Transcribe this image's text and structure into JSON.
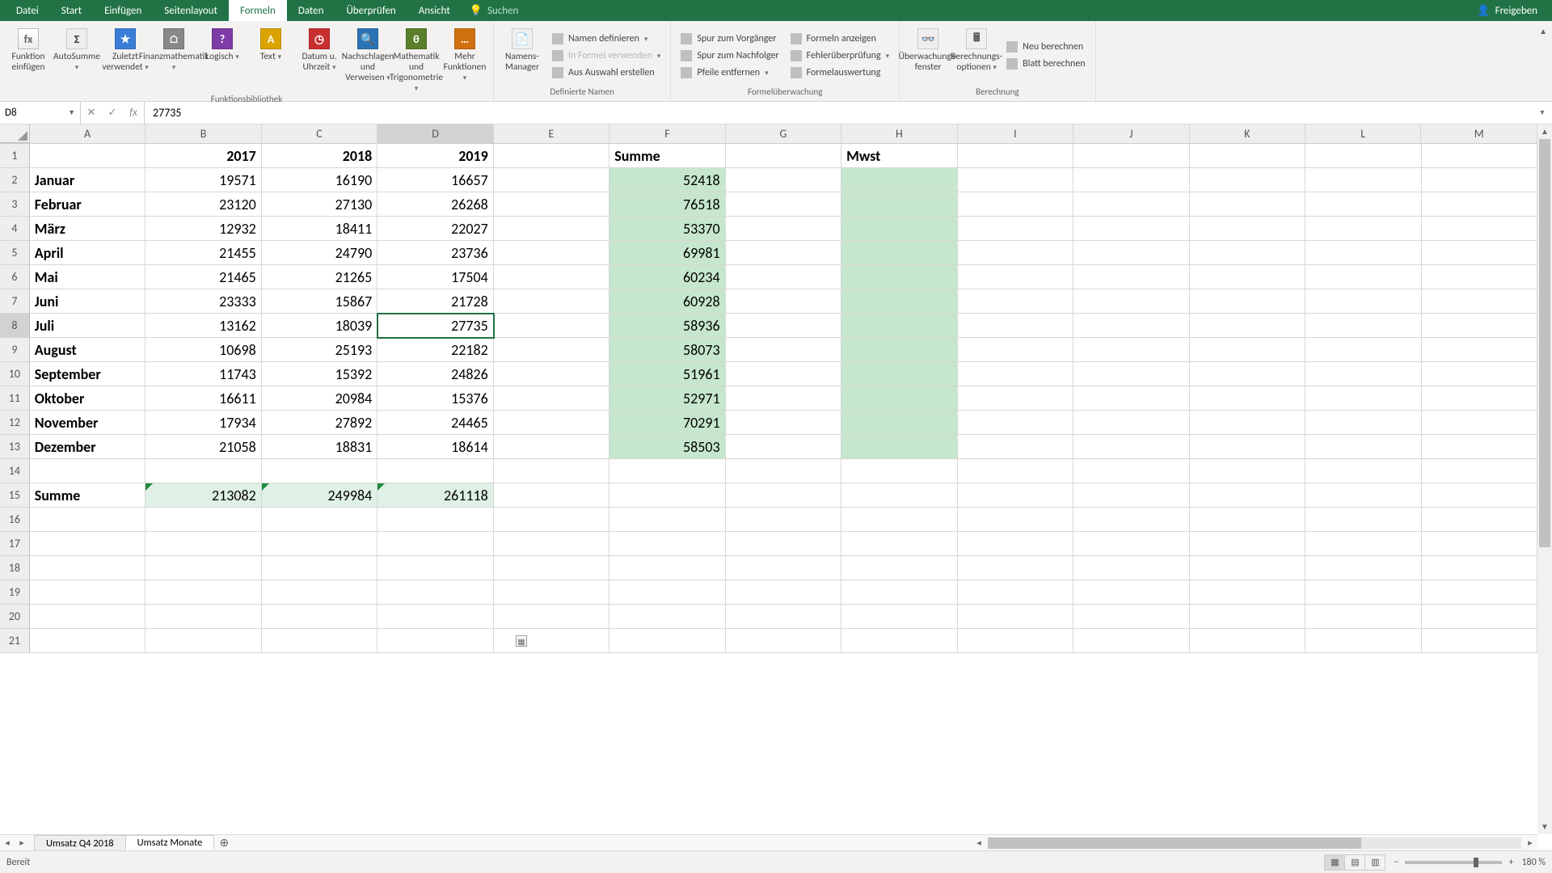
{
  "tabs": [
    "Datei",
    "Start",
    "Einfügen",
    "Seitenlayout",
    "Formeln",
    "Daten",
    "Überprüfen",
    "Ansicht"
  ],
  "active_tab_index": 4,
  "search_placeholder": "Suchen",
  "share_label": "Freigeben",
  "ribbon": {
    "fn_insert": "Funktion einfügen",
    "autosum": "AutoSumme",
    "recent": "Zuletzt verwendet",
    "financial": "Finanzmathematik",
    "logical": "Logisch",
    "text": "Text",
    "date_time": "Datum u. Uhrzeit",
    "lookup": "Nachschlagen und Verweisen",
    "math": "Mathematik und Trigonometrie",
    "more": "Mehr Funktionen",
    "group_library": "Funktionsbibliothek",
    "name_mgr": "Namens-Manager",
    "define_name": "Namen definieren",
    "use_in_formula": "In Formel verwenden",
    "create_from_sel": "Aus Auswahl erstellen",
    "group_names": "Definierte Namen",
    "trace_prec": "Spur zum Vorgänger",
    "trace_dep": "Spur zum Nachfolger",
    "remove_arrows": "Pfeile entfernen",
    "show_formulas": "Formeln anzeigen",
    "error_check": "Fehlerüberprüfung",
    "eval_formula": "Formelauswertung",
    "group_audit": "Formelüberwachung",
    "watch": "Überwachungs-fenster",
    "calc_opts": "Berechnungs-optionen",
    "calc_now": "Neu berechnen",
    "calc_sheet": "Blatt berechnen",
    "group_calc": "Berechnung"
  },
  "namebox": "D8",
  "formula_value": "27735",
  "columns": [
    "A",
    "B",
    "C",
    "D",
    "E",
    "F",
    "G",
    "H",
    "I",
    "J",
    "K",
    "L",
    "M"
  ],
  "selected_col_index": 3,
  "selected_row_index": 7,
  "headers": {
    "summe": "Summe",
    "mwst": "Mwst",
    "y2017": "2017",
    "y2018": "2018",
    "y2019": "2019"
  },
  "row_label_summe": "Summe",
  "months": [
    "Januar",
    "Februar",
    "März",
    "April",
    "Mai",
    "Juni",
    "Juli",
    "August",
    "September",
    "Oktober",
    "November",
    "Dezember"
  ],
  "vals2017": [
    19571,
    23120,
    12932,
    21455,
    21465,
    23333,
    13162,
    10698,
    11743,
    16611,
    17934,
    21058
  ],
  "vals2018": [
    16190,
    27130,
    18411,
    24790,
    21265,
    15867,
    18039,
    25193,
    15392,
    20984,
    27892,
    18831
  ],
  "vals2019": [
    16657,
    26268,
    22027,
    23736,
    17504,
    21728,
    27735,
    22182,
    24826,
    15376,
    24465,
    18614
  ],
  "valsSumF": [
    52418,
    76518,
    53370,
    69981,
    60234,
    60928,
    58936,
    58073,
    51961,
    52971,
    70291,
    58503
  ],
  "totals": {
    "b": "213082",
    "c": "249984",
    "d": "261118"
  },
  "sheet_tabs": [
    "Umsatz Q4 2018",
    "Umsatz Monate"
  ],
  "active_sheet_index": 1,
  "status": "Bereit",
  "zoom": "180 %"
}
